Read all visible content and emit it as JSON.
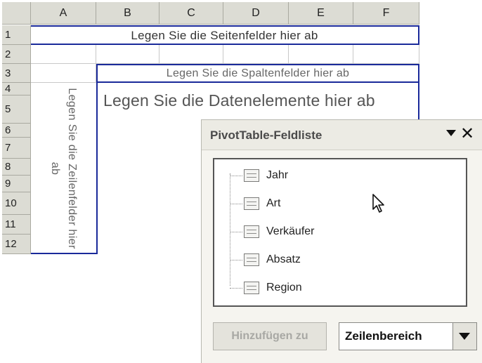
{
  "spreadsheet": {
    "columns": [
      "A",
      "B",
      "C",
      "D",
      "E",
      "F"
    ],
    "rows": [
      "1",
      "2",
      "3",
      "4",
      "5",
      "6",
      "7",
      "8",
      "9",
      "10",
      "11",
      "12"
    ],
    "page_fields_drop_label": "Legen Sie die Seitenfelder hier ab",
    "column_fields_drop_label": "Legen Sie die Spaltenfelder hier ab",
    "data_items_drop_label": "Legen Sie die Datenelemente hier ab",
    "row_fields_drop_label": "Legen Sie die Zeilenfelder hier ab"
  },
  "field_list_panel": {
    "title": "PivotTable-Feldliste",
    "dropdown_icon": "chevron-down-icon",
    "close_icon": "close-icon",
    "fields": [
      {
        "label": "Jahr",
        "icon": "field-icon"
      },
      {
        "label": "Art",
        "icon": "field-icon"
      },
      {
        "label": "Verkäufer",
        "icon": "field-icon"
      },
      {
        "label": "Absatz",
        "icon": "field-icon"
      },
      {
        "label": "Region",
        "icon": "field-icon"
      }
    ],
    "add_button_label": "Hinzufügen zu",
    "area_select": {
      "value": "Zeilenbereich",
      "options": [
        "Zeilenbereich"
      ]
    }
  },
  "colors": {
    "drop_zone_border": "#1a2a9a",
    "header_background": "#dcdcd4",
    "panel_background": "#f5f4ef"
  }
}
